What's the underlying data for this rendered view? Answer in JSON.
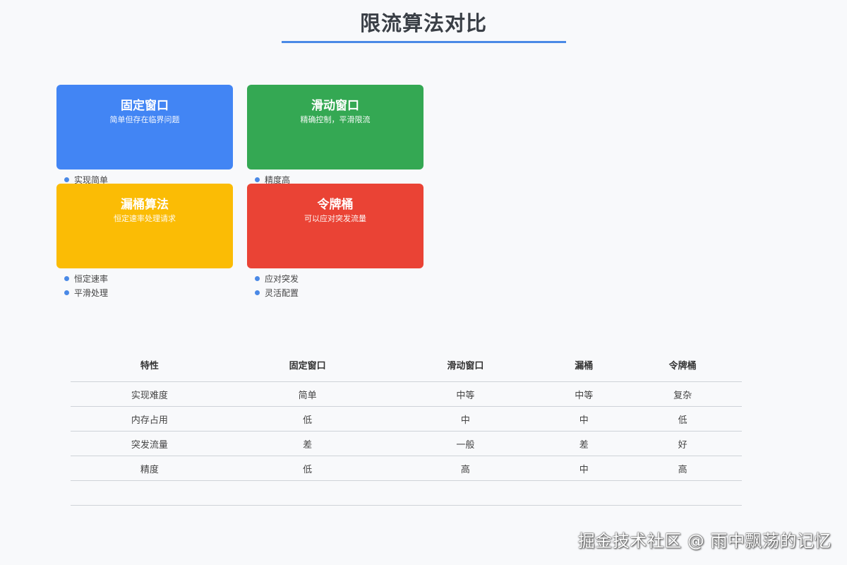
{
  "title": "限流算法对比",
  "colors": {
    "accent": "#4a89e6",
    "fixed_window": "#4285f4",
    "sliding_window": "#34a853",
    "leaky_bucket": "#fbbc05",
    "token_bucket": "#ea4335"
  },
  "cards": [
    {
      "title": "固定窗口",
      "desc": "简单但存在临界问题",
      "points": [
        "实现简单"
      ]
    },
    {
      "title": "滑动窗口",
      "desc": "精确控制，平滑限流",
      "points": [
        "精度高"
      ]
    },
    {
      "title": "漏桶算法",
      "desc": "恒定速率处理请求",
      "points": [
        "恒定速率",
        "平滑处理"
      ]
    },
    {
      "title": "令牌桶",
      "desc": "可以应对突发流量",
      "points": [
        "应对突发",
        "灵活配置"
      ]
    }
  ],
  "table": {
    "headers": [
      "特性",
      "固定窗口",
      "滑动窗口",
      "漏桶",
      "令牌桶"
    ],
    "rows": [
      [
        "实现难度",
        "简单",
        "中等",
        "中等",
        "复杂"
      ],
      [
        "内存占用",
        "低",
        "中",
        "中",
        "低"
      ],
      [
        "突发流量",
        "差",
        "一般",
        "差",
        "好"
      ],
      [
        "精度",
        "低",
        "高",
        "中",
        "高"
      ]
    ]
  },
  "watermark": "掘金技术社区 @ 雨中飘荡的记忆"
}
